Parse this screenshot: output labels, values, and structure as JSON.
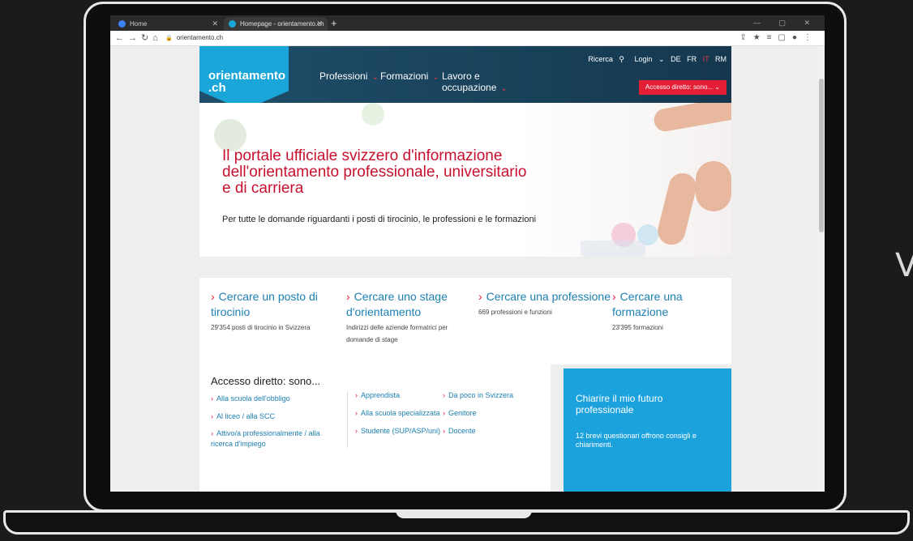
{
  "browser": {
    "tabs": [
      {
        "label": "Home",
        "active": false
      },
      {
        "label": "Homepage - orientamento.ch",
        "active": true
      }
    ],
    "address": "orientamento.ch"
  },
  "site": {
    "logo_line1": "orientamento",
    "logo_line2": ".ch",
    "menu": [
      {
        "label": "Professioni"
      },
      {
        "label": "Formazioni"
      },
      {
        "label": "Lavoro e"
      },
      {
        "label": "occupazione"
      }
    ],
    "util": {
      "search": "Ricerca",
      "login": "Login",
      "langs": [
        "DE",
        "FR",
        "IT",
        "RM"
      ]
    },
    "cta_label": "Accesso diretto: sono...",
    "hero": {
      "title": "Il portale ufficiale svizzero d'informazione dell'orientamento professionale, universitario e di carriera",
      "subtitle": "Per tutte le domande riguardanti i posti di tirocinio, le professioni e le formazioni"
    },
    "quick_links": [
      {
        "title": "Cercare un posto di tirocinio",
        "desc": "29'354 posti di tirocinio in Svizzera"
      },
      {
        "title": "Cercare uno stage d'orientamento",
        "desc": "Indirizzi delle aziende formatrici per domande di stage"
      },
      {
        "title": "Cercare una professione",
        "desc": "669 professioni e funzioni"
      },
      {
        "title": "Cercare una formazione",
        "desc": "23'395 formazioni"
      }
    ],
    "access": {
      "title": "Accesso diretto: sono...",
      "col1": [
        "Alla scuola dell'obbligo",
        "Al liceo / alla SCC",
        "Attivo/a professionalmente / alla ricerca d'impiego"
      ],
      "col2": [
        "Apprendista",
        "Alla scuola specializzata",
        "Studente (SUP/ASP/uni)"
      ],
      "col3": [
        "Da poco in Svizzera",
        "Genitore",
        "Docente"
      ]
    },
    "promo": {
      "title": "Chiarire il mio futuro professionale",
      "text": "12 brevi questionari offrono consigli e chiarimenti."
    }
  },
  "side_letter": "V",
  "colors": {
    "brand_blue": "#1aa6d9",
    "nav_dark": "#1f4e6a",
    "accent_red": "#e31e35",
    "link_blue": "#1c7fb1"
  }
}
